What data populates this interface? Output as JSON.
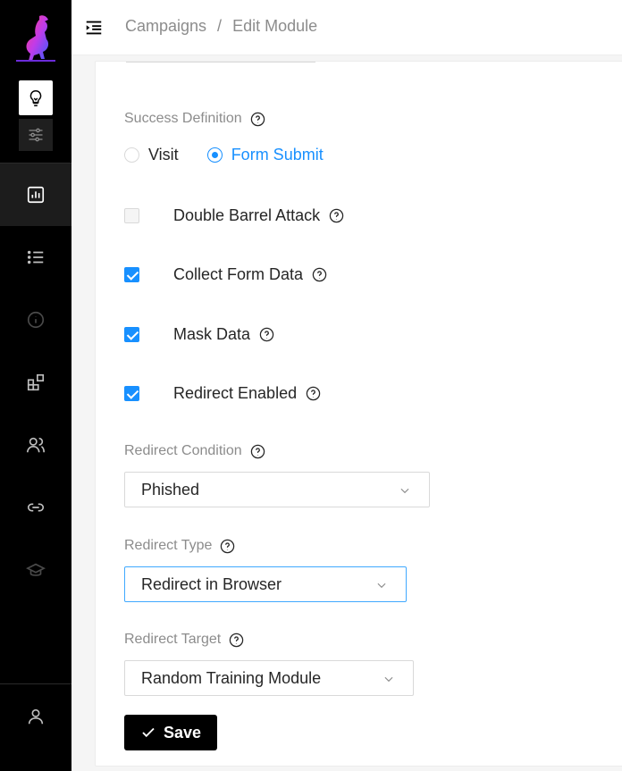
{
  "header": {
    "breadcrumb": [
      "Campaigns",
      "Edit Module"
    ],
    "separator": "/"
  },
  "sidebar": {
    "items": [
      {
        "icon": "lightbulb-icon",
        "active": false
      },
      {
        "icon": "sliders-icon",
        "active": false
      },
      {
        "icon": "bar-chart-icon",
        "active": true
      },
      {
        "icon": "list-icon",
        "active": false
      },
      {
        "icon": "info-icon",
        "active": false
      },
      {
        "icon": "modules-icon",
        "active": false
      },
      {
        "icon": "users-icon",
        "active": false
      },
      {
        "icon": "link-icon",
        "active": false
      },
      {
        "icon": "graduation-cap-icon",
        "active": false
      },
      {
        "icon": "user-icon",
        "active": false
      }
    ]
  },
  "form": {
    "success_definition": {
      "label": "Success Definition",
      "options": [
        {
          "label": "Visit",
          "selected": false
        },
        {
          "label": "Form Submit",
          "selected": true
        }
      ]
    },
    "checkboxes": [
      {
        "label": "Double Barrel Attack",
        "checked": false
      },
      {
        "label": "Collect Form Data",
        "checked": true
      },
      {
        "label": "Mask Data",
        "checked": true
      },
      {
        "label": "Redirect Enabled",
        "checked": true
      }
    ],
    "redirect_condition": {
      "label": "Redirect Condition",
      "value": "Phished"
    },
    "redirect_type": {
      "label": "Redirect Type",
      "value": "Redirect in Browser"
    },
    "redirect_target": {
      "label": "Redirect Target",
      "value": "Random Training Module"
    },
    "save_label": "Save"
  },
  "colors": {
    "accent": "#1890ff",
    "sidebar_bg": "#000000",
    "muted_text": "#8c8c8c"
  }
}
